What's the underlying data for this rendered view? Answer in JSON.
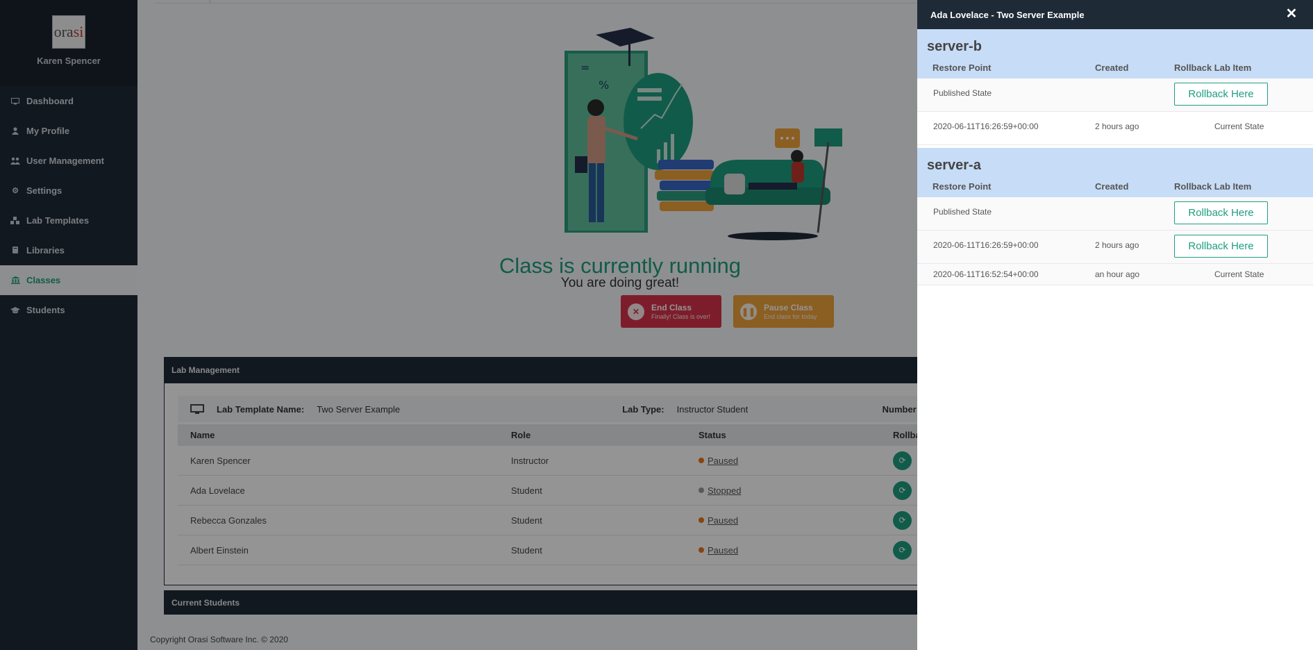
{
  "sidebar": {
    "logo_text": "orasi",
    "user_name": "Karen Spencer",
    "items": [
      {
        "label": "Dashboard",
        "icon": "monitor-icon"
      },
      {
        "label": "My Profile",
        "icon": "user-icon"
      },
      {
        "label": "User Management",
        "icon": "users-icon"
      },
      {
        "label": "Settings",
        "icon": "gear-icon"
      },
      {
        "label": "Lab Templates",
        "icon": "cubes-icon"
      },
      {
        "label": "Libraries",
        "icon": "book-icon"
      },
      {
        "label": "Classes",
        "icon": "bank-icon",
        "active": true
      },
      {
        "label": "Students",
        "icon": "graduation-cap-icon"
      }
    ]
  },
  "main": {
    "status_title": "Class is currently running",
    "status_subtitle": "You are doing great!",
    "end_class": {
      "title": "End Class",
      "subtitle": "Finally! Class is over!"
    },
    "pause_class": {
      "title": "Pause Class",
      "subtitle": "End class for today"
    },
    "lab_management_title": "Lab Management",
    "lab_info": {
      "template_label": "Lab Template Name:",
      "template_value": "Two Server Example",
      "type_label": "Lab Type:",
      "type_value": "Instructor Student",
      "number_label": "Number"
    },
    "table_headers": {
      "name": "Name",
      "role": "Role",
      "status": "Status",
      "rollback": "Rollba"
    },
    "rows": [
      {
        "name": "Karen Spencer",
        "role": "Instructor",
        "status": "Paused"
      },
      {
        "name": "Ada Lovelace",
        "role": "Student",
        "status": "Stopped"
      },
      {
        "name": "Rebecca Gonzales",
        "role": "Student",
        "status": "Paused"
      },
      {
        "name": "Albert Einstein",
        "role": "Student",
        "status": "Paused"
      }
    ],
    "current_students_title": "Current Students",
    "footer": "Copyright Orasi Software Inc. © 2020"
  },
  "drawer": {
    "title": "Ada Lovelace - Two Server Example",
    "close_icon": "close-icon",
    "col_restore": "Restore Point",
    "col_created": "Created",
    "col_rollback": "Rollback Lab Item",
    "servers": [
      {
        "name": "server-b",
        "rows": [
          {
            "restore": "Published State",
            "created": "",
            "action": "Rollback Here"
          },
          {
            "restore": "2020-06-11T16:26:59+00:00",
            "created": "2 hours ago",
            "action": "Current State"
          }
        ]
      },
      {
        "name": "server-a",
        "rows": [
          {
            "restore": "Published State",
            "created": "",
            "action": "Rollback Here"
          },
          {
            "restore": "2020-06-11T16:26:59+00:00",
            "created": "2 hours ago",
            "action": "Rollback Here"
          },
          {
            "restore": "2020-06-11T16:52:54+00:00",
            "created": "an hour ago",
            "action": "Current State"
          }
        ]
      }
    ]
  },
  "colors": {
    "sidebar_bg": "#1f2a37",
    "accent_green": "#1e9e80",
    "end_red": "#d8334a",
    "pause_orange": "#f0a33c",
    "server_header_blue": "#c7dcf6",
    "status_paused": "#e8751a",
    "status_stopped": "#9a9a9a"
  }
}
